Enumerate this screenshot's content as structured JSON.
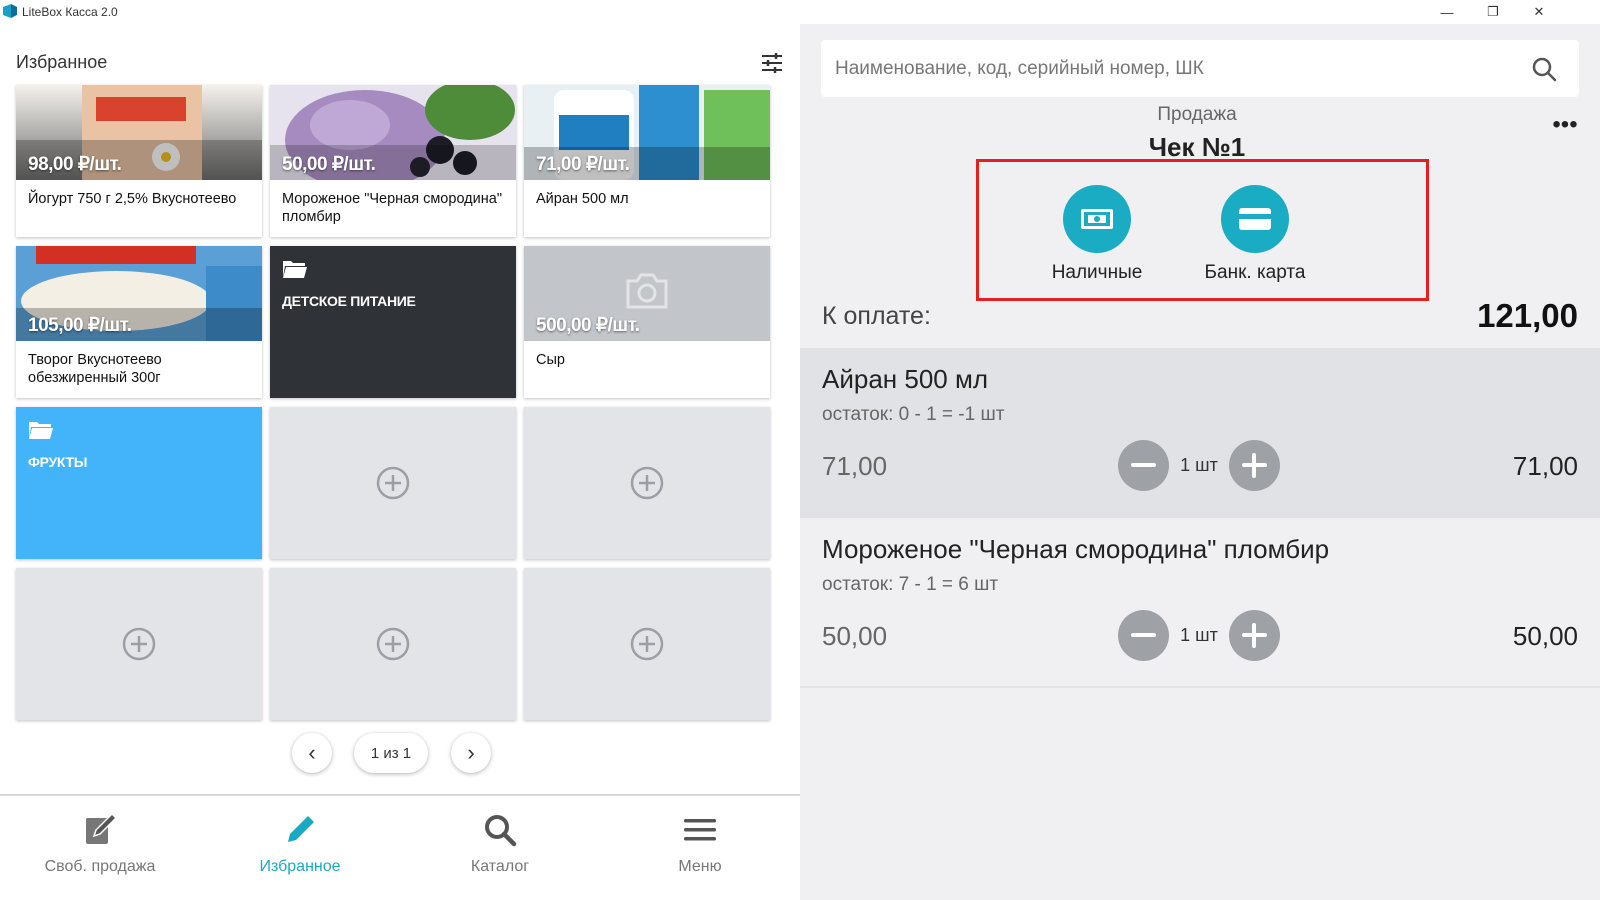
{
  "window": {
    "title": "LiteBox Касса 2.0",
    "minimize_glyph": "—",
    "restore_glyph": "❐",
    "close_glyph": "✕"
  },
  "favorites": {
    "title": "Избранное",
    "tiles": [
      {
        "price": "98,00 ₽/шт.",
        "name": "Йогурт 750 г 2,5% Вкуснотеево",
        "image": "yogurt-photo"
      },
      {
        "price": "50,00 ₽/шт.",
        "name": "Мороженое \"Черная смородина\" пломбир",
        "image": "ice-cream-photo"
      },
      {
        "price": "71,00 ₽/шт.",
        "name": "Айран 500 мл",
        "image": "ayran-photo"
      },
      {
        "price": "105,00 ₽/шт.",
        "name": "Творог Вкуснотеево обезжиренный 300г",
        "image": "cottage-cheese-photo"
      },
      {
        "folder": "ДЕТСКОЕ ПИТАНИЕ"
      },
      {
        "price": "500,00 ₽/шт.",
        "name": "Сыр",
        "image": "camera-placeholder-icon"
      },
      {
        "folder": "ФРУКТЫ"
      }
    ],
    "pager": {
      "prev": "‹",
      "page": "1 из 1",
      "next": "›"
    }
  },
  "bottom_nav": [
    {
      "label": "Своб. продажа",
      "icon": "edit-note-icon"
    },
    {
      "label": "Избранное",
      "icon": "pencil-icon",
      "active": true
    },
    {
      "label": "Каталог",
      "icon": "search-icon"
    },
    {
      "label": "Меню",
      "icon": "hamburger-icon"
    }
  ],
  "search": {
    "placeholder": "Наименование, код, серийный номер, ШК"
  },
  "receipt": {
    "sale_label": "Продажа",
    "check_title": "Чек №1",
    "more": "•••",
    "payment": [
      {
        "label": "Наличные",
        "icon": "cash-icon"
      },
      {
        "label": "Банк. карта",
        "icon": "card-icon"
      }
    ],
    "to_pay_label": "К оплате:",
    "to_pay_value": "121,00",
    "items": [
      {
        "name": "Айран 500 мл",
        "rest": "остаток: 0 - 1 = -1 шт",
        "price": "71,00",
        "qty": "1 шт",
        "total": "71,00"
      },
      {
        "name": "Мороженое \"Черная смородина\" пломбир",
        "rest": "остаток: 7 - 1 = 6 шт",
        "price": "50,00",
        "qty": "1 шт",
        "total": "50,00"
      }
    ]
  },
  "colors": {
    "accent": "#1aacc2",
    "folder_blue": "#44b4fa",
    "folder_dark": "#2f3236",
    "highlight": "#e32020"
  }
}
